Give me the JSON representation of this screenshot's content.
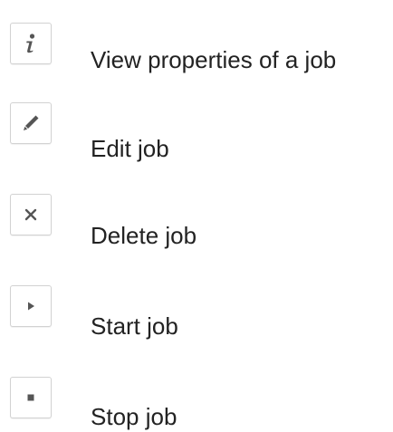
{
  "actions": [
    {
      "label": "View properties of a job",
      "icon": "info-icon"
    },
    {
      "label": "Edit job",
      "icon": "pencil-icon"
    },
    {
      "label": "Delete job",
      "icon": "close-icon"
    },
    {
      "label": "Start job",
      "icon": "play-icon"
    },
    {
      "label": "Stop job",
      "icon": "stop-icon"
    }
  ],
  "colors": {
    "icon": "#555555",
    "border": "#d2d2d2",
    "text": "#222222"
  }
}
